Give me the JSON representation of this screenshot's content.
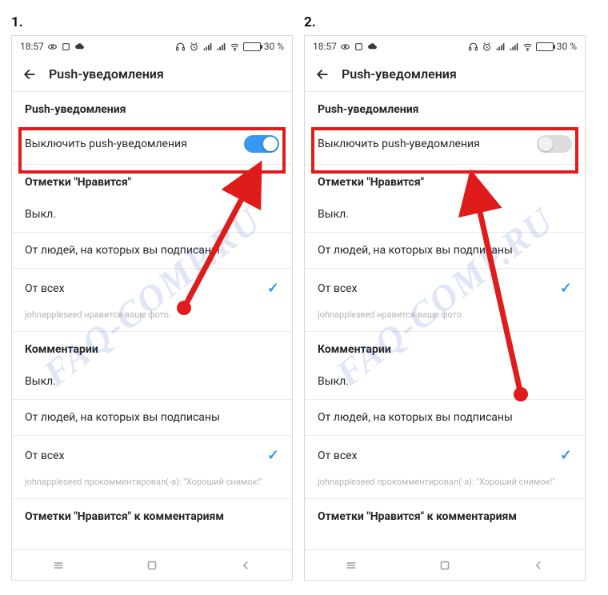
{
  "watermark": "FAQ-COMP.RU",
  "steps": [
    {
      "label": "1."
    },
    {
      "label": "2."
    }
  ],
  "statusbar": {
    "time": "18:57",
    "battery_pct": "30 %"
  },
  "appbar": {
    "title": "Push-уведомления"
  },
  "sections": {
    "push": {
      "title": "Push-уведомления",
      "toggle_label": "Выключить push-уведомления"
    },
    "likes": {
      "title": "Отметки \"Нравится\"",
      "opt_off": "Выкл.",
      "opt_following": "От людей, на которых вы подписаны",
      "opt_everyone": "От всех",
      "helper": "johnappleseed нравится ваше фото."
    },
    "comments": {
      "title": "Комментарии",
      "opt_off": "Выкл.",
      "opt_following": "От людей, на которых вы подписаны",
      "opt_everyone": "От всех",
      "helper": "johnappleseed прокомментировал(-а): \"Хороший снимок!\""
    },
    "likes_on_comments": {
      "title": "Отметки \"Нравится\" к комментариям"
    }
  },
  "screens": [
    {
      "toggle_on": true
    },
    {
      "toggle_on": false
    }
  ]
}
